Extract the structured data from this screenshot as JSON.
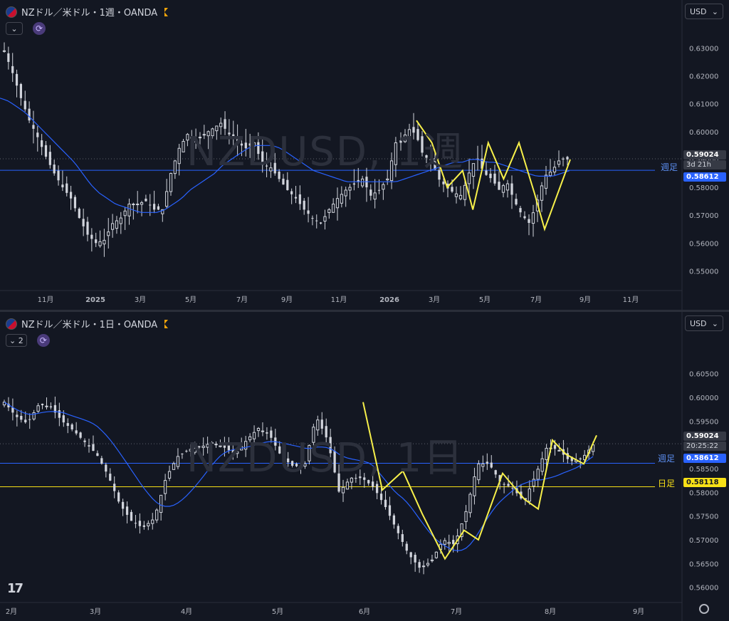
{
  "top": {
    "title": "NZドル／米ドル・1週・OANDA",
    "collapse_label": "⌄",
    "currency": "USD",
    "watermark": "NZDUSD, 1週",
    "price_tag": "0.59024",
    "countdown": "3d 21h",
    "weekly_tag": "0.58612",
    "weekly_label": "週足",
    "y_ticks": [
      "0.63000",
      "0.62000",
      "0.61000",
      "0.60000",
      "0.59000",
      "0.58000",
      "0.57000",
      "0.56000",
      "0.55000"
    ],
    "x_ticks": [
      "11月",
      "2025",
      "3月",
      "5月",
      "7月",
      "9月",
      "11月",
      "2026",
      "3月",
      "5月",
      "7月",
      "9月",
      "11月"
    ]
  },
  "bottom": {
    "title": "NZドル／米ドル・1日・OANDA",
    "collapse_label": "⌄ 2",
    "currency": "USD",
    "watermark": "NZDUSD, 1日",
    "price_tag": "0.59024",
    "countdown": "20:25:22",
    "weekly_tag": "0.58612",
    "weekly_label": "週足",
    "daily_tag": "0.58118",
    "daily_label": "日足",
    "y_ticks": [
      "0.60500",
      "0.60000",
      "0.59500",
      "0.59000",
      "0.58500",
      "0.58000",
      "0.57500",
      "0.57000",
      "0.56500",
      "0.56000"
    ],
    "x_ticks": [
      "2月",
      "3月",
      "4月",
      "5月",
      "6月",
      "7月",
      "8月",
      "9月"
    ],
    "logo": "17"
  },
  "colors": {
    "background": "#131722",
    "candle": "#d1d4dc",
    "ma": "#2962ff",
    "weekly_line": "#2962ff",
    "daily_line": "#f7e017",
    "zigzag": "#f7f04a"
  },
  "chart_data": [
    {
      "type": "candlestick",
      "title": "NZドル／米ドル・1週・OANDA",
      "ylim": [
        0.545,
        0.637
      ],
      "y_ticks": [
        0.63,
        0.62,
        0.61,
        0.6,
        0.59,
        0.58,
        0.57,
        0.56,
        0.55
      ],
      "x_ticks": [
        "11月",
        "2025",
        "3月",
        "5月",
        "7月",
        "9月",
        "11月",
        "2026",
        "3月",
        "5月",
        "7月",
        "9月",
        "11月"
      ],
      "horizontal_lines": [
        {
          "label": "週足",
          "value": 0.58612
        }
      ],
      "last_price": 0.59024,
      "close_path": [
        0.629,
        0.621,
        0.612,
        0.604,
        0.598,
        0.591,
        0.585,
        0.58,
        0.576,
        0.569,
        0.563,
        0.56,
        0.561,
        0.567,
        0.569,
        0.574,
        0.574,
        0.575,
        0.572,
        0.572,
        0.585,
        0.594,
        0.599,
        0.597,
        0.599,
        0.601,
        0.603,
        0.599,
        0.596,
        0.594,
        0.596,
        0.588,
        0.587,
        0.583,
        0.579,
        0.576,
        0.572,
        0.569,
        0.567,
        0.572,
        0.576,
        0.579,
        0.581,
        0.583,
        0.577,
        0.579,
        0.583,
        0.596,
        0.601,
        0.599,
        0.591,
        0.59,
        0.583,
        0.58,
        0.578,
        0.577,
        0.585,
        0.591,
        0.585,
        0.583,
        0.579,
        0.582,
        0.575,
        0.57,
        0.567,
        0.575,
        0.584,
        0.586,
        0.59,
        0.59
      ],
      "moving_average_path": [
        0.612,
        0.611,
        0.609,
        0.607,
        0.604,
        0.601,
        0.598,
        0.595,
        0.592,
        0.589,
        0.585,
        0.581,
        0.578,
        0.576,
        0.574,
        0.573,
        0.572,
        0.571,
        0.571,
        0.571,
        0.572,
        0.574,
        0.576,
        0.579,
        0.581,
        0.583,
        0.585,
        0.588,
        0.59,
        0.592,
        0.594,
        0.595,
        0.595,
        0.595,
        0.594,
        0.592,
        0.59,
        0.588,
        0.586,
        0.585,
        0.584,
        0.583,
        0.582,
        0.582,
        0.582,
        0.582,
        0.582,
        0.582,
        0.582,
        0.583,
        0.584,
        0.585,
        0.586,
        0.587,
        0.588,
        0.589,
        0.589,
        0.59,
        0.59,
        0.589,
        0.589,
        0.588,
        0.587,
        0.586,
        0.585,
        0.584,
        0.584,
        0.584,
        0.585,
        0.586
      ],
      "zigzag": [
        [
          0.604,
          0
        ],
        [
          0.596,
          3
        ],
        [
          0.58,
          6
        ],
        [
          0.586,
          9
        ],
        [
          0.572,
          11
        ],
        [
          0.596,
          14
        ],
        [
          0.583,
          17
        ],
        [
          0.596,
          20
        ],
        [
          0.578,
          23
        ],
        [
          0.565,
          25
        ],
        [
          0.59,
          30
        ]
      ]
    },
    {
      "type": "candlestick",
      "title": "NZドル／米ドル・1日・OANDA",
      "ylim": [
        0.5595,
        0.6078
      ],
      "y_ticks": [
        0.605,
        0.6,
        0.595,
        0.59,
        0.585,
        0.58,
        0.575,
        0.57,
        0.565,
        0.56
      ],
      "x_ticks": [
        "2月",
        "3月",
        "4月",
        "5月",
        "6月",
        "7月",
        "8月",
        "9月"
      ],
      "horizontal_lines": [
        {
          "label": "週足",
          "value": 0.58612
        },
        {
          "label": "日足",
          "value": 0.58118
        }
      ],
      "last_price": 0.59024
    }
  ]
}
